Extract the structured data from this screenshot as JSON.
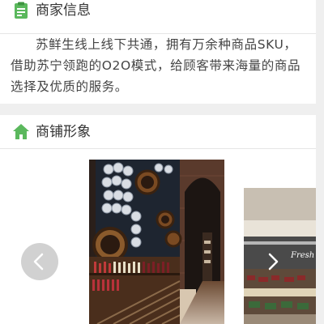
{
  "merchant_info": {
    "title": "商家信息",
    "icon": "clipboard-icon",
    "description": "苏鲜生线上线下共通，拥有万余种商品SKU，借助苏宁领跑的O2O模式，给顾客带来海量的商品选择及优质的服务。"
  },
  "store_images": {
    "title": "商铺形象",
    "icon": "home-icon",
    "slide_2_sign": "Fresh",
    "prev_icon": "chevron-left-icon",
    "next_icon": "chevron-right-icon"
  },
  "colors": {
    "accent_green": "#5bb85d",
    "page_bg": "#efefef",
    "card_bg": "#ffffff"
  }
}
